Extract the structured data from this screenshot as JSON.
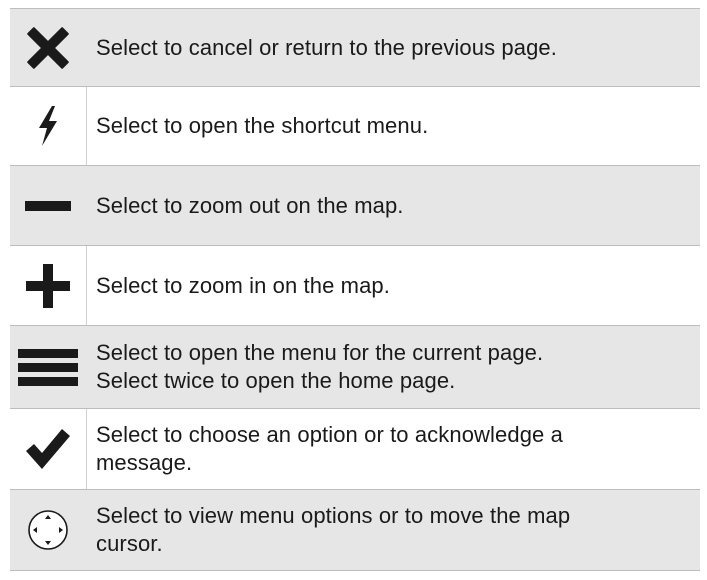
{
  "rows": [
    {
      "icon": "close-icon",
      "text": "Select to cancel or return to the previous page."
    },
    {
      "icon": "lightning-bolt-icon",
      "text": "Select to open the shortcut menu."
    },
    {
      "icon": "minus-icon",
      "text": "Select to zoom out on the map."
    },
    {
      "icon": "plus-icon",
      "text": "Select to zoom in on the map."
    },
    {
      "icon": "menu-icon",
      "lines": [
        "Select to open the menu for the current page.",
        "Select twice to open the home page."
      ]
    },
    {
      "icon": "checkmark-icon",
      "lines": [
        "Select to choose an option or to acknowledge a",
        "message."
      ]
    },
    {
      "icon": "direction-pad-icon",
      "lines": [
        "Select to view menu options or to move the map",
        "cursor."
      ]
    }
  ],
  "colors": {
    "shaded_row": "#e6e6e6",
    "text": "#1a1a1a",
    "icon": "#1a1a1a",
    "border": "#bdbdbd"
  }
}
